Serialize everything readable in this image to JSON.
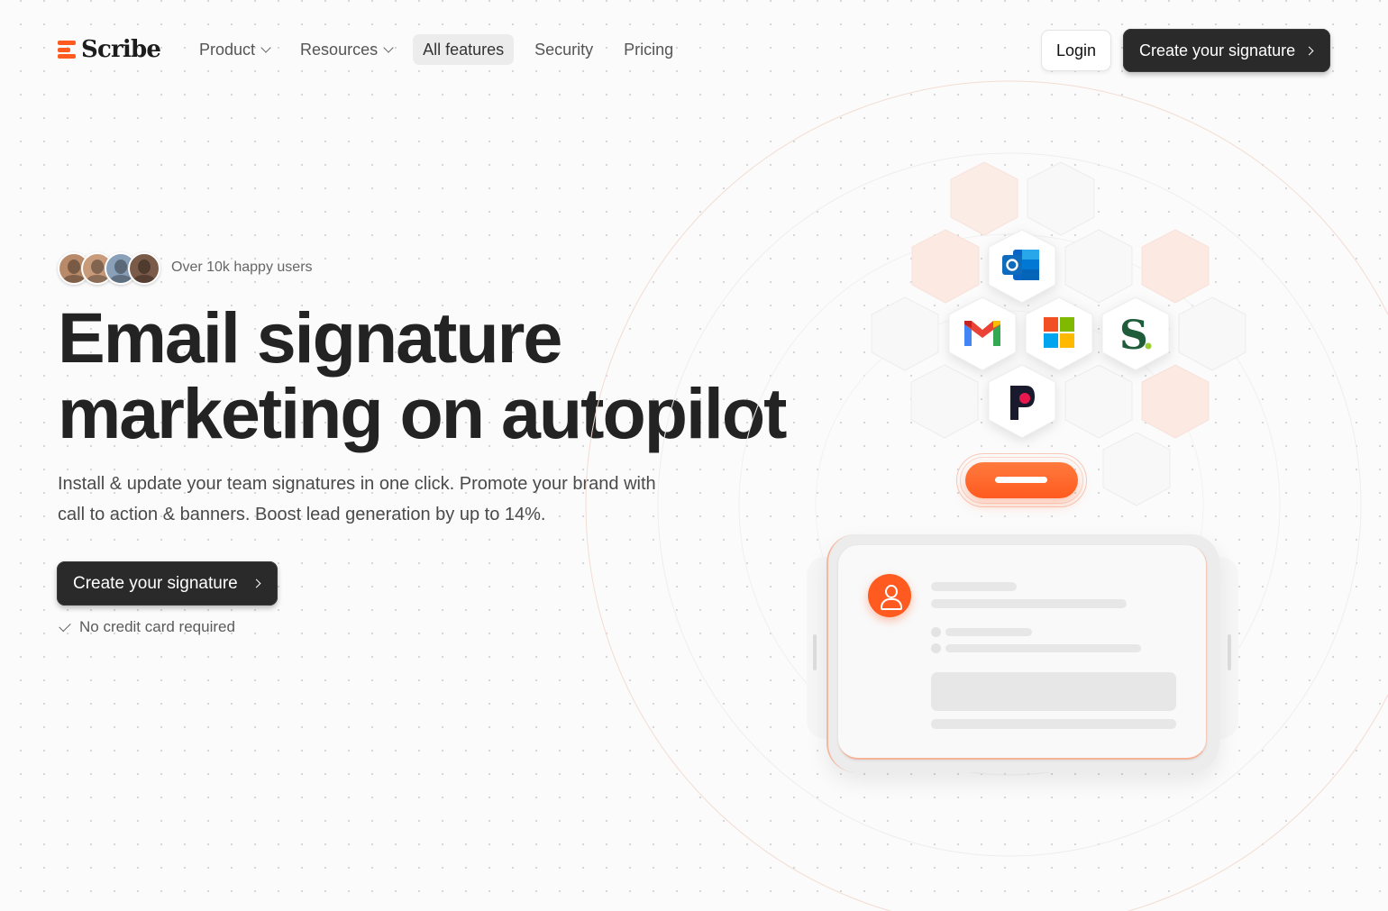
{
  "brand": {
    "name": "Scribe",
    "accent": "#ff5a1f",
    "dark": "#2a2a2a"
  },
  "nav": {
    "items": [
      {
        "label": "Product",
        "has_dropdown": true,
        "active": false
      },
      {
        "label": "Resources",
        "has_dropdown": true,
        "active": false
      },
      {
        "label": "All features",
        "has_dropdown": false,
        "active": true
      },
      {
        "label": "Security",
        "has_dropdown": false,
        "active": false
      },
      {
        "label": "Pricing",
        "has_dropdown": false,
        "active": false
      }
    ],
    "login_label": "Login",
    "cta_label": "Create your signature"
  },
  "hero": {
    "social_proof": "Over 10k happy users",
    "headline_line1": "Email signature",
    "headline_line2": "marketing on autopilot",
    "subtext": "Install & update your team signatures in one click. Promote your brand with call to action & banners. Boost lead generation by up to 14%.",
    "cta_label": "Create your signature",
    "note": "No credit card required"
  },
  "illustration": {
    "integrations": [
      "outlook-icon",
      "gmail-icon",
      "microsoft-icon",
      "scribe-s-icon",
      "pipedrive-icon"
    ]
  }
}
